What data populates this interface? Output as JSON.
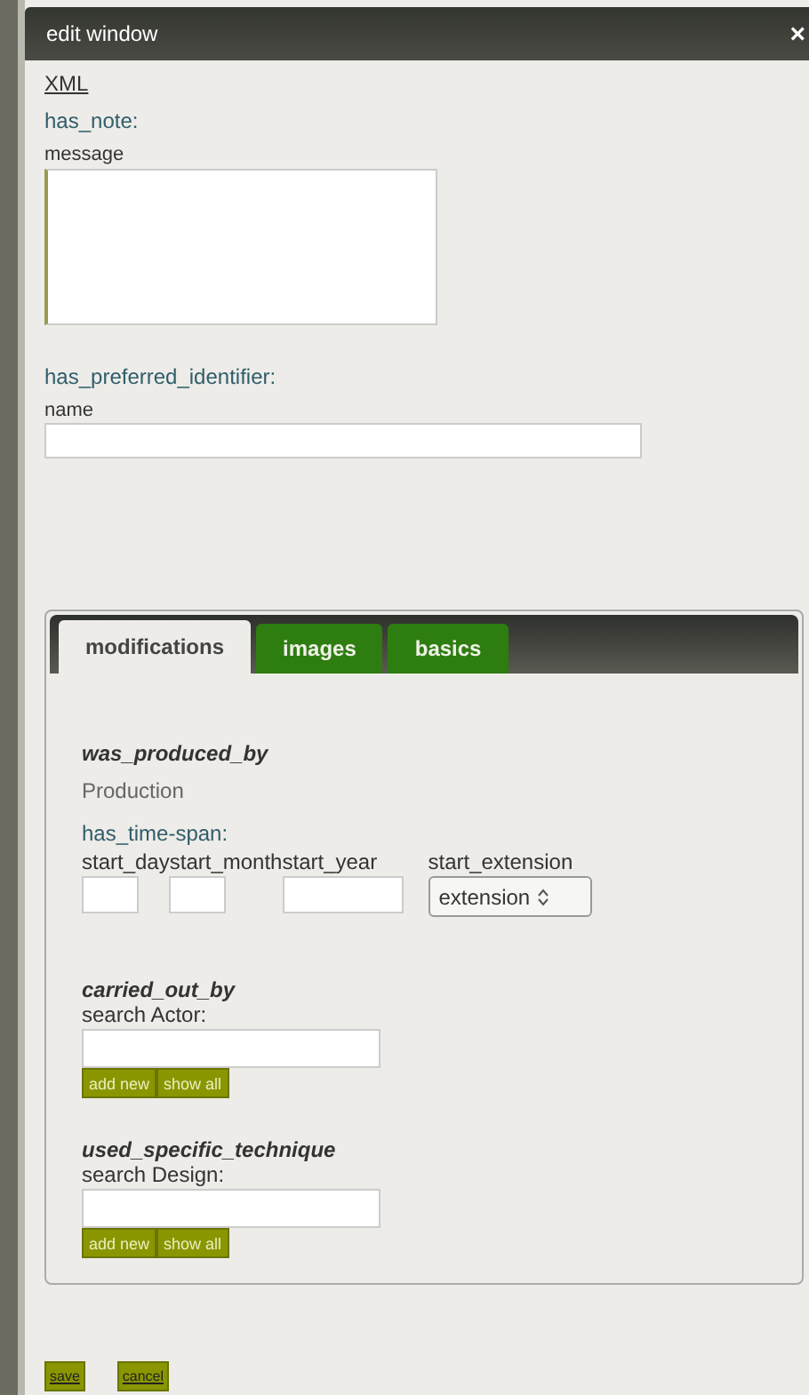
{
  "window": {
    "title": "edit window",
    "close": "×"
  },
  "xml_link": "XML",
  "has_note": {
    "label": "has_note:",
    "field_label": "message"
  },
  "has_preferred_identifier": {
    "label": "has_preferred_identifier:",
    "field_label": "name"
  },
  "tabs": [
    {
      "label": "modifications",
      "selected": true
    },
    {
      "label": "images",
      "selected": false
    },
    {
      "label": "basics",
      "selected": false
    }
  ],
  "produced": {
    "title": "was_produced_by",
    "type": "Production",
    "span_label": "has_time-span:",
    "date_fields": [
      {
        "label": "start_day",
        "kind": "short"
      },
      {
        "label": "start_month",
        "kind": "short"
      },
      {
        "label": "start_year",
        "kind": "long"
      },
      {
        "label": "start_extension",
        "kind": "select",
        "value": "extension"
      }
    ]
  },
  "relations": [
    {
      "title": "carried_out_by",
      "search_label": "search Actor:",
      "buttons": [
        "add new",
        "show all"
      ]
    },
    {
      "title": "used_specific_technique",
      "search_label": "search Design:",
      "buttons": [
        "add new",
        "show all"
      ]
    }
  ],
  "footer_buttons": [
    "save",
    "cancel"
  ]
}
